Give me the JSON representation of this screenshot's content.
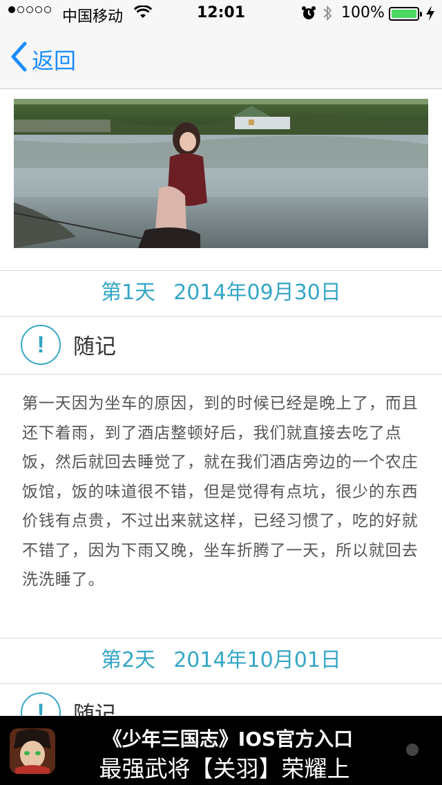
{
  "status_bar": {
    "carrier": "中国移动",
    "time": "12:01",
    "battery": "100%",
    "signal_bars_filled": 1,
    "signal_bars_total": 5
  },
  "nav": {
    "back_label": "返回"
  },
  "days": [
    {
      "day": "第1天",
      "date": "2014年09月30日",
      "note_title": "随记",
      "note_icon": "!",
      "text": "第一天因为坐车的原因，到的时候已经是晚上了，而且还下着雨，到了酒店整顿好后，我们就直接去吃了点饭，然后就回去睡觉了，就在我们酒店旁边的一个农庄饭馆，饭的味道很不错，但是觉得有点坑，很少的东西价钱有点贵，不过出来就这样，已经习惯了，吃的好就不错了，因为下雨又晚，坐车折腾了一天，所以就回去洗洗睡了。"
    },
    {
      "day": "第2天",
      "date": "2014年10月01日",
      "note_title": "随记",
      "note_icon": "!"
    }
  ],
  "ad": {
    "line1": "《少年三国志》IOS官方入口",
    "line2": "最强武将【关羽】荣耀上"
  },
  "colors": {
    "accent": "#35a6c6",
    "link": "#1a8cff",
    "battery": "#4cd964"
  }
}
